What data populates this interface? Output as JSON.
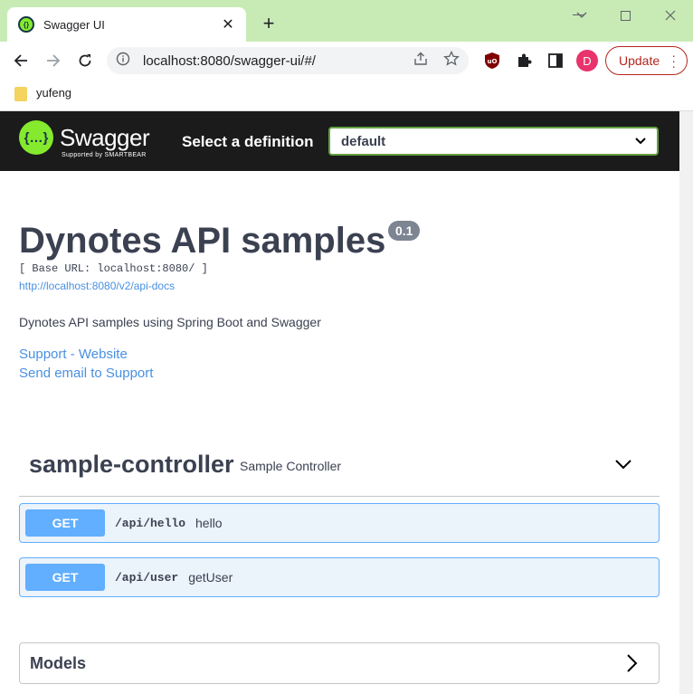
{
  "browser": {
    "tab_title": "Swagger UI",
    "tab_favicon_glyph": "{}",
    "new_tab_glyph": "+",
    "address": "localhost:8080/swagger-ui/#/",
    "profile_initial": "D",
    "update_label": "Update",
    "bookmark": "yufeng"
  },
  "topbar": {
    "logo_glyph": "{…}",
    "logo_text": "Swagger",
    "logo_sub": "Supported by SMARTBEAR",
    "select_label": "Select a definition",
    "select_value": "default"
  },
  "info": {
    "title": "Dynotes API samples",
    "version": "0.1",
    "base_url": "[ Base URL: localhost:8080/ ]",
    "api_docs_link": "http://localhost:8080/v2/api-docs",
    "description": "Dynotes API samples using Spring Boot and Swagger",
    "support_link": "Support - Website",
    "email_link": "Send email to Support"
  },
  "tag": {
    "name": "sample-controller",
    "description": "Sample Controller"
  },
  "operations": [
    {
      "method": "GET",
      "path": "/api/hello",
      "summary": "hello"
    },
    {
      "method": "GET",
      "path": "/api/user",
      "summary": "getUser"
    }
  ],
  "models": {
    "title": "Models"
  },
  "colors": {
    "tab_strip": "#c8ebb6",
    "swagger_green": "#85ea2d",
    "get_blue": "#61affe",
    "link_blue": "#4990e2",
    "update_red": "#b3261e"
  }
}
